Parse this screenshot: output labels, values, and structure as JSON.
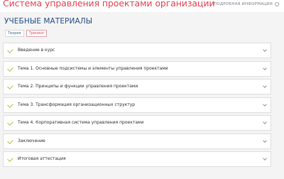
{
  "header": {
    "title": "Система управления проектами организации",
    "more_info": "ПОДРОБНАЯ ИНФОРМАЦИЯ"
  },
  "section": {
    "title": "УЧЕБНЫЕ МАТЕРИАЛЫ"
  },
  "tabs": [
    {
      "label": "Теория",
      "active": false
    },
    {
      "label": "Тренинг",
      "active": true
    }
  ],
  "modules": [
    {
      "label": "Введение в курс"
    },
    {
      "label": "Тема 1. Основные подсистемы и элементы управления проектами"
    },
    {
      "label": "Тема 2. Принципы и функции управления проектами"
    },
    {
      "label": "Тема 3. Трансформация организационных структур"
    },
    {
      "label": "Тема 4. Корпоративная система управления проектами"
    },
    {
      "label": "Заключение"
    },
    {
      "label": "Итоговая аттестация"
    }
  ],
  "colors": {
    "accent": "#e2404f",
    "section_title": "#234d86",
    "check": "#a7c24a"
  }
}
